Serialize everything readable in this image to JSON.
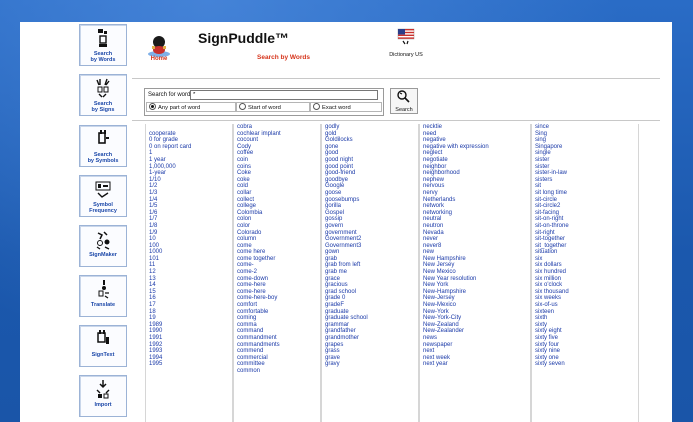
{
  "sidebar": {
    "items": [
      {
        "label": "Search\nby Words",
        "icon": "search-by-words-icon"
      },
      {
        "label": "Search\nby Signs",
        "icon": "search-by-signs-icon"
      },
      {
        "label": "Search\nby Symbols",
        "icon": "search-by-symbols-icon"
      },
      {
        "label": "Symbol\nFrequency",
        "icon": "symbol-frequency-icon"
      },
      {
        "label": "SignMaker",
        "icon": "signmaker-icon"
      },
      {
        "label": "Translate",
        "icon": "translate-icon"
      },
      {
        "label": "SignText",
        "icon": "signtext-icon"
      },
      {
        "label": "Import",
        "icon": "import-icon"
      }
    ]
  },
  "header": {
    "home_label": "Home",
    "title": "SignPuddle™",
    "subtitle": "Search by Words",
    "dictionary_label": "Dictionary US"
  },
  "search": {
    "label": "Search for word:",
    "value": "*",
    "options": [
      {
        "label": "Any part of word",
        "selected": true
      },
      {
        "label": "Start of word",
        "selected": false
      },
      {
        "label": "Exact word",
        "selected": false
      }
    ],
    "button_label": "Search"
  },
  "results": {
    "columns": [
      [
        "",
        "cooperate",
        "0 for grade",
        "0 on report card",
        "1",
        "1 year",
        "1,000,000",
        "1-year",
        "1/10",
        "1/2",
        "1/3",
        "1/4",
        "1/5",
        "1/6",
        "1/7",
        "1/8",
        "1/9",
        "10",
        "100",
        "1000",
        "101",
        "11",
        "12",
        "13",
        "14",
        "15",
        "16",
        "17",
        "18",
        "19",
        "1989",
        "1990",
        "1991",
        "1992",
        "1993",
        "1994",
        "1995"
      ],
      [
        "cobra",
        "cochlear implant",
        "cocount",
        "Cody",
        "coffee",
        "coin",
        "coins",
        "Coke",
        "coke",
        "cold",
        "collar",
        "collect",
        "college",
        "Colombia",
        "colon",
        "color",
        "Colorado",
        "column",
        "come",
        "come here",
        "come together",
        "come-",
        "come-2",
        "come-down",
        "come-here",
        "come-here",
        "come-here-boy",
        "comfort",
        "comfortable",
        "coming",
        "comma",
        "command",
        "commandment",
        "commandments",
        "commend",
        "commercial",
        "committee",
        "common"
      ],
      [
        "godly",
        "gold",
        "Goldilocks",
        "gone",
        "good",
        "good night",
        "good point",
        "good-friend",
        "goodbye",
        "Google",
        "goose",
        "goosebumps",
        "gorilla",
        "Gospel",
        "gossip",
        "govern",
        "government",
        "Government2",
        "Government3",
        "gown",
        "grab",
        "grab from left",
        "grab me",
        "grace",
        "gracious",
        "grad school",
        "grade 0",
        "gradeF",
        "graduate",
        "graduate school",
        "grammar",
        "grandfather",
        "grandmother",
        "grapes",
        "grass",
        "grave",
        "gravy"
      ],
      [
        "necktie",
        "need",
        "negative",
        "negative with expression",
        "neglect",
        "negotiate",
        "neighbor",
        "neighborhood",
        "nephew",
        "nervous",
        "nervy",
        "Netherlands",
        "network",
        "networking",
        "neutral",
        "neutron",
        "Nevada",
        "never",
        "never8",
        "new",
        "New Hampshire",
        "New Jersey",
        "New Mexico",
        "New Year resolution",
        "New York",
        "New-Hampshire",
        "New-Jersey",
        "New-Mexico",
        "New-York",
        "New-York-City",
        "New-Zealand",
        "New-Zealander",
        "news",
        "newspaper",
        "next",
        "next week",
        "next year"
      ],
      [
        "since",
        "Sing",
        "sing",
        "Singapore",
        "single",
        "sister",
        "sister",
        "sister-in-law",
        "sisters",
        "sit",
        "sit long time",
        "sit-circle",
        "sit-circle2",
        "sit-facing",
        "sit-on-right",
        "sit-on-throne",
        "sit-right",
        "sit-together",
        "sit_together",
        "situation",
        "six",
        "six dollars",
        "six hundred",
        "six million",
        "six o'clock",
        "six thousand",
        "six weeks",
        "six-of-us",
        "sixteen",
        "sixth",
        "sixty",
        "sixty eight",
        "sixty five",
        "sixty four",
        "sixty nine",
        "sixty one",
        "sixty seven"
      ]
    ]
  },
  "colors": {
    "background": "#1d5fb8",
    "link": "#1b3aa8",
    "accent_red": "#d6341b",
    "sidebar_label": "#1b47a8"
  }
}
